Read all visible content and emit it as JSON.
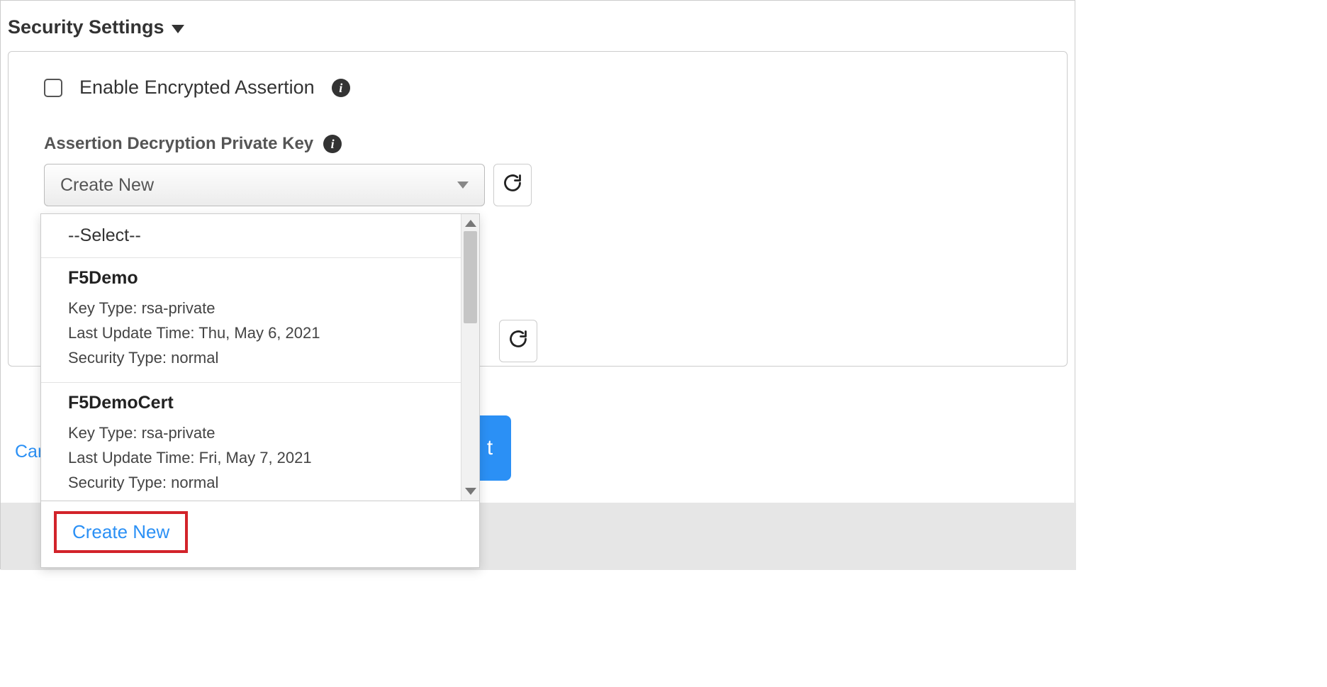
{
  "section": {
    "title": "Security Settings"
  },
  "encrypt": {
    "label": "Enable Encrypted Assertion"
  },
  "assertion_key": {
    "label": "Assertion Decryption Private Key",
    "selected": "Create New"
  },
  "dropdown": {
    "placeholder": "--Select--",
    "options": [
      {
        "name": "F5Demo",
        "key_type_label": "Key Type:",
        "key_type": "rsa-private",
        "update_label": "Last Update Time:",
        "update": "Thu, May 6, 2021",
        "sec_label": "Security Type:",
        "sec": "normal"
      },
      {
        "name": "F5DemoCert",
        "key_type_label": "Key Type:",
        "key_type": "rsa-private",
        "update_label": "Last Update Time:",
        "update": "Fri, May 7, 2021",
        "sec_label": "Security Type:",
        "sec": "normal"
      }
    ],
    "create_new": "Create New"
  },
  "footer": {
    "cancel": "Can",
    "next_fragment": "t"
  }
}
